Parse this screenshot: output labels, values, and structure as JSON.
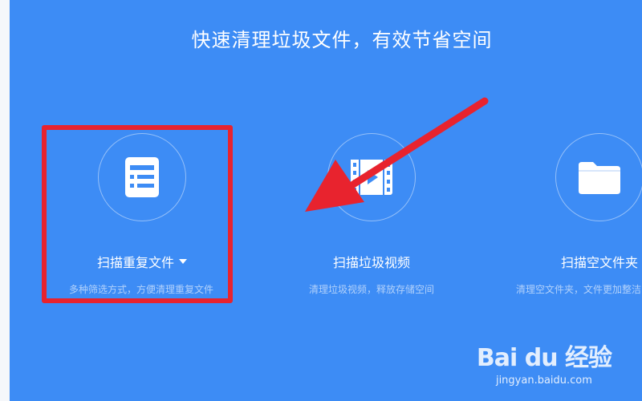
{
  "headline": "快速清理垃圾文件，有效节省空间",
  "features": [
    {
      "title": "扫描重复文件",
      "desc": "多种筛选方式，方便清理重复文件",
      "icon": "document-list-icon",
      "has_dropdown": true
    },
    {
      "title": "扫描垃圾视频",
      "desc": "清理垃圾视频，释放存储空间",
      "icon": "video-film-icon",
      "has_dropdown": false
    },
    {
      "title": "扫描空文件夹",
      "desc": "清理空文件夹，文件更加整洁",
      "icon": "folder-icon",
      "has_dropdown": false
    }
  ],
  "watermark": {
    "logo_text": "Bai du 经验",
    "url": "jingyan.baidu.com"
  },
  "colors": {
    "background": "#3d8cf5",
    "highlight": "#e8232e"
  }
}
